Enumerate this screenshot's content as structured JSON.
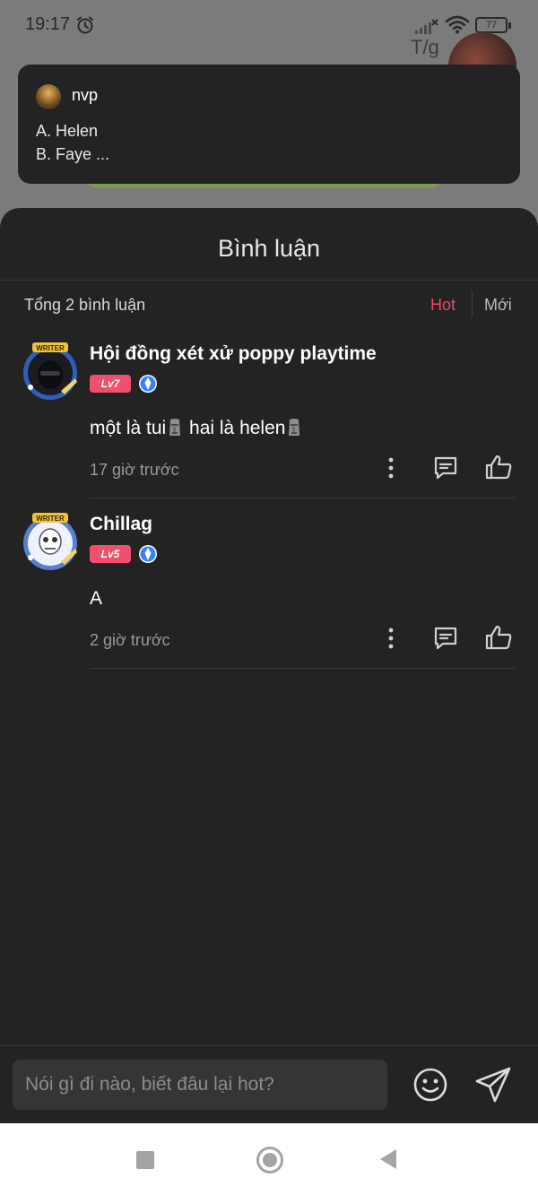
{
  "status_bar": {
    "time": "19:17",
    "battery": "77",
    "icons": [
      "alarm-icon",
      "signal-icon",
      "wifi-icon",
      "battery-icon"
    ]
  },
  "background": {
    "tg_label": "T/g"
  },
  "notification": {
    "username": "nvp",
    "lines": [
      "A. Helen",
      "B. Faye ..."
    ]
  },
  "sheet": {
    "title": "Bình luận",
    "total_label": "Tổng 2 bình luận",
    "sort_options": [
      "Hot",
      "Mới"
    ],
    "active_sort": "Hot"
  },
  "comments": [
    {
      "name": "Hội đồng xét xử poppy playtime",
      "level": "Lv7",
      "text_parts": [
        "một là tui",
        " hai là helen",
        ""
      ],
      "time": "17 giờ trước"
    },
    {
      "name": "Chillag",
      "level": "Lv5",
      "text": "A",
      "time": "2 giờ trước"
    }
  ],
  "composer": {
    "placeholder": "Nói gì đi nào, biết đâu lại hot?"
  },
  "colors": {
    "accent": "#f04864",
    "sheet_bg": "#232323",
    "level_badge": "#f0506e",
    "verified_badge": "#3b82f6"
  }
}
